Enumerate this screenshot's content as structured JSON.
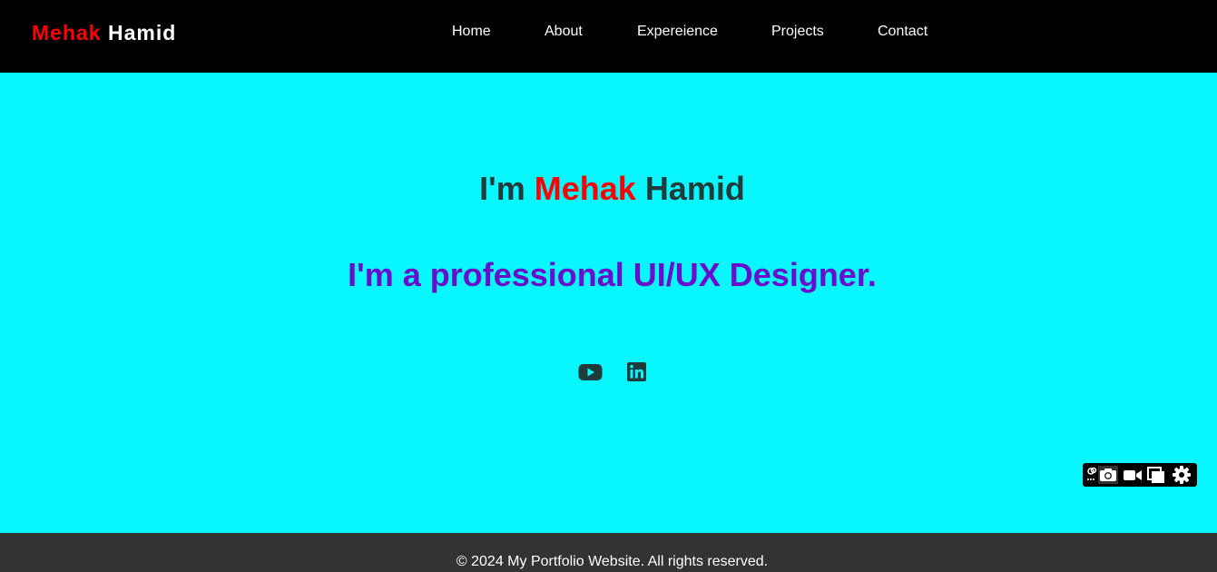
{
  "header": {
    "logo_first": "Mehak",
    "logo_last": "Hamid",
    "nav": [
      {
        "label": "Home"
      },
      {
        "label": "About"
      },
      {
        "label": "Expereience"
      },
      {
        "label": "Projects"
      },
      {
        "label": "Contact"
      }
    ]
  },
  "hero": {
    "title_prefix": "I'm",
    "title_first": "Mehak",
    "title_last": "Hamid",
    "subtitle": "I'm a professional UI/UX Designer.",
    "socials": [
      {
        "icon": "youtube-icon"
      },
      {
        "icon": "linkedin-icon"
      }
    ]
  },
  "toolbar": {
    "icons": [
      "link-icon",
      "camera-icon",
      "video-camera-icon",
      "copy-icon",
      "gear-icon"
    ]
  },
  "footer": {
    "text": "© 2024 My Portfolio Website. All rights reserved."
  },
  "colors": {
    "header_bg": "#000000",
    "hero_bg": "#08f6fd",
    "accent_red": "#ff0000",
    "subtitle_purple": "#6a0dcc",
    "footer_bg": "#333333"
  }
}
